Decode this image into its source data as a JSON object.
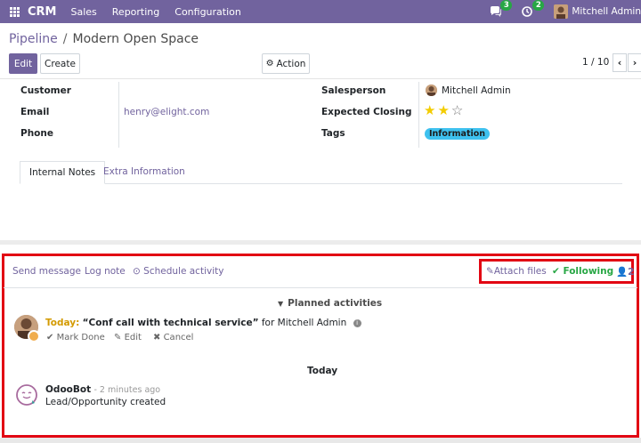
{
  "navbar": {
    "brand": "CRM",
    "menu": [
      "Sales",
      "Reporting",
      "Configuration"
    ],
    "messages_count": "3",
    "activities_count": "2",
    "user_name": "Mitchell Admin",
    "bg_color": "#71639e"
  },
  "breadcrumb": {
    "parent": "Pipeline",
    "separator": "/",
    "current": "Modern Open Space"
  },
  "toolbar": {
    "edit_label": "Edit",
    "create_label": "Create",
    "action_label": "Action",
    "pager_value": "1 / 10",
    "pager_prev": "‹",
    "pager_next": "›"
  },
  "form": {
    "customer_label": "Customer",
    "customer_value": "",
    "email_label": "Email",
    "email_value": "henry@elight.com",
    "phone_label": "Phone",
    "phone_value": "",
    "salesperson_label": "Salesperson",
    "salesperson_value": "Mitchell Admin",
    "expected_closing_label": "Expected Closing",
    "priority_stars": 2,
    "priority_max": 3,
    "tags_label": "Tags",
    "tag": "Information",
    "tag_color": "#3ec1ef"
  },
  "tabs": {
    "internal_notes": "Internal Notes",
    "extra_information": "Extra Information"
  },
  "chatter": {
    "send_message": "Send message",
    "log_note": "Log note",
    "schedule_activity": "Schedule activity",
    "attach_files": "Attach files",
    "following": "Following",
    "followers_count": "2",
    "planned_activities": "Planned activities",
    "activity": {
      "due": "Today:",
      "summary": "“Conf call with technical service”",
      "assignee_text": "for Mitchell Admin",
      "mark_done": "Mark Done",
      "edit": "Edit",
      "cancel": "Cancel"
    },
    "date_separator": "Today",
    "message": {
      "author": "OdooBot",
      "time": "- 2 minutes ago",
      "body": "Lead/Opportunity created"
    }
  },
  "colors": {
    "accent": "#71639e",
    "highlight_border": "#e20613",
    "following_green": "#28a745",
    "today_yellow": "#d39a00"
  }
}
